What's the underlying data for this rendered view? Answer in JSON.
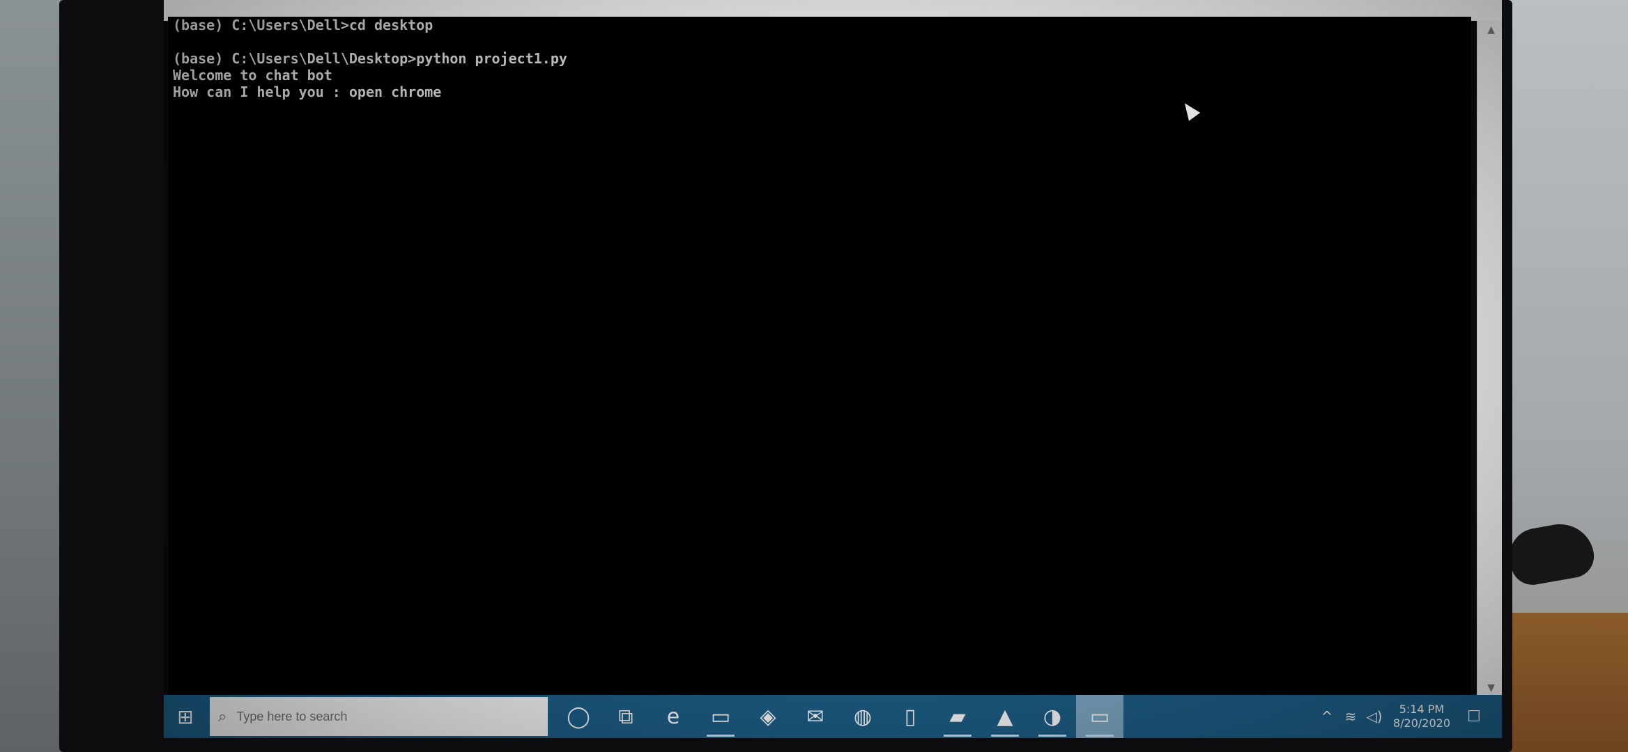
{
  "console": {
    "lines": [
      "(base) C:\\Users\\Dell>cd desktop",
      "",
      "(base) C:\\Users\\Dell\\Desktop>python project1.py",
      "Welcome to chat bot",
      "How can I help you : open chrome"
    ]
  },
  "taskbar": {
    "start_label": "⊞",
    "search": {
      "icon": "search-icon",
      "placeholder": "Type here to search"
    },
    "apps": [
      {
        "name": "cortana-icon",
        "glyph": "◯"
      },
      {
        "name": "task-view-icon",
        "glyph": "⧉"
      },
      {
        "name": "edge-icon",
        "glyph": "e"
      },
      {
        "name": "file-explorer-icon",
        "glyph": "▭"
      },
      {
        "name": "store-icon",
        "glyph": "◈"
      },
      {
        "name": "mail-icon",
        "glyph": "✉"
      },
      {
        "name": "browser-icon",
        "glyph": "◍"
      },
      {
        "name": "phone-icon",
        "glyph": "▯"
      },
      {
        "name": "notes-icon",
        "glyph": "▰"
      },
      {
        "name": "photos-icon",
        "glyph": "▲"
      },
      {
        "name": "chrome-icon",
        "glyph": "◑"
      },
      {
        "name": "terminal-icon",
        "glyph": "▭"
      }
    ],
    "tray": {
      "chevron": "^",
      "network": "≋",
      "volume": "◁)",
      "time": "5:14 PM",
      "date": "8/20/2020",
      "notification": "☐"
    }
  }
}
